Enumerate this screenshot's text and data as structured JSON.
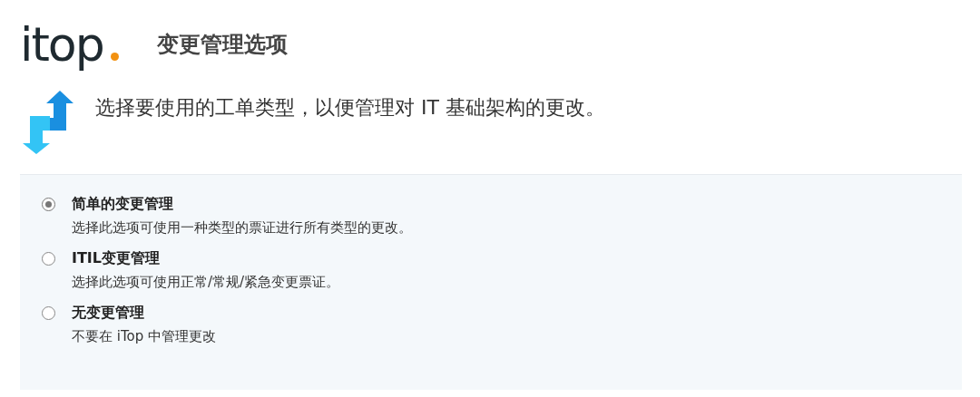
{
  "header": {
    "logo": "itop",
    "title": "变更管理选项"
  },
  "intro": "选择要使用的工单类型，以便管理对 IT 基础架构的更改。",
  "options": [
    {
      "label": "简单的变更管理",
      "description": "选择此选项可使用一种类型的票证进行所有类型的更改。",
      "selected": true
    },
    {
      "label": "ITIL变更管理",
      "description": "选择此选项可使用正常/常规/紧急变更票证。",
      "selected": false
    },
    {
      "label": "无变更管理",
      "description": "不要在 iTop 中管理更改",
      "selected": false
    }
  ]
}
